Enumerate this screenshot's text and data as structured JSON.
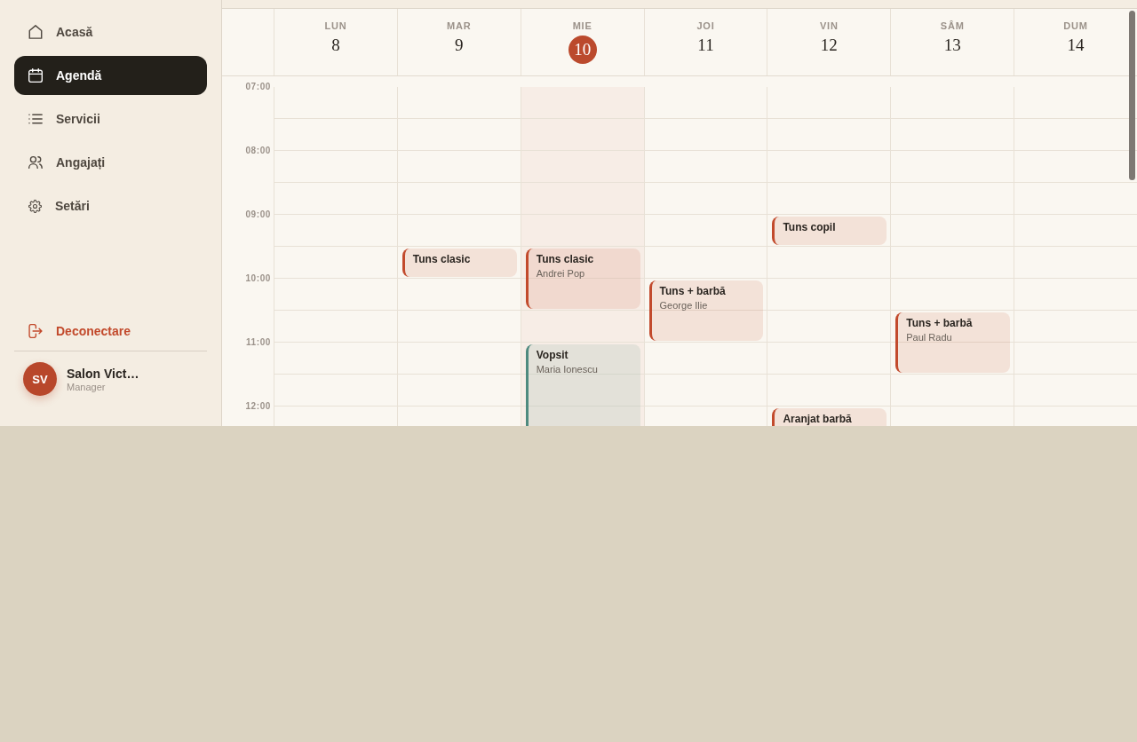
{
  "sidebar": {
    "nav_items": [
      {
        "label": "Acasă",
        "selected": false
      },
      {
        "label": "Agendă",
        "selected": true
      },
      {
        "label": "Servicii",
        "selected": false
      },
      {
        "label": "Angajați",
        "selected": false
      },
      {
        "label": "Setări",
        "selected": false
      }
    ],
    "logout": {
      "label": "Deconectare"
    },
    "user": {
      "initials": "SV",
      "name": "Salon Vict…",
      "role": "Manager"
    }
  },
  "calendar": {
    "days": [
      {
        "weekday": "LUN",
        "date": "8",
        "today": false
      },
      {
        "weekday": "MAR",
        "date": "9",
        "today": false
      },
      {
        "weekday": "MIE",
        "date": "10",
        "today": true
      },
      {
        "weekday": "JOI",
        "date": "11",
        "today": false
      },
      {
        "weekday": "VIN",
        "date": "12",
        "today": false
      },
      {
        "weekday": "SÂM",
        "date": "13",
        "today": false
      },
      {
        "weekday": "DUM",
        "date": "14",
        "today": false
      }
    ],
    "rows": [
      {
        "time": "07:00"
      },
      {},
      {
        "time": "08:00"
      },
      {},
      {
        "time": "09:00",
        "cells": [
          {},
          {},
          {},
          {},
          {
            "events": [
              {
                "title": "Tuns copil",
                "kind": "half",
                "color": "#c24a2c"
              }
            ]
          },
          {},
          {}
        ]
      },
      {
        "cells": [
          {},
          {
            "events": [
              {
                "title": "Tuns clasic",
                "kind": "half",
                "color": "#c24a2c"
              }
            ]
          },
          {
            "events": [
              {
                "title": "Tuns clasic",
                "client": "Andrei Pop",
                "kind": "hour",
                "color": "#c24a2c"
              }
            ]
          },
          {},
          {},
          {},
          {}
        ]
      },
      {
        "time": "10:00",
        "cells": [
          {},
          {},
          {},
          {
            "events": [
              {
                "title": "Tuns + barbă",
                "client": "George Ilie",
                "kind": "hour",
                "color": "#c24a2c"
              }
            ]
          },
          {},
          {},
          {}
        ]
      },
      {
        "cells": [
          {},
          {},
          {},
          {},
          {},
          {
            "events": [
              {
                "title": "Tuns + barbă",
                "client": "Paul Radu",
                "kind": "hour",
                "color": "#c24a2c"
              }
            ]
          },
          {}
        ]
      },
      {
        "time": "11:00",
        "cells": [
          {},
          {},
          {
            "events": [
              {
                "title": "Vopsit",
                "client": "Maria Ionescu",
                "kind": "open",
                "color": "#4f8a7f"
              }
            ]
          },
          {},
          {},
          {},
          {}
        ]
      },
      {},
      {
        "time": "12:00",
        "cells": [
          {},
          {},
          {},
          {},
          {
            "events": [
              {
                "title": "Aranjat barbă",
                "kind": "open",
                "color": "#c24a2c"
              }
            ]
          },
          {},
          {}
        ]
      }
    ]
  }
}
